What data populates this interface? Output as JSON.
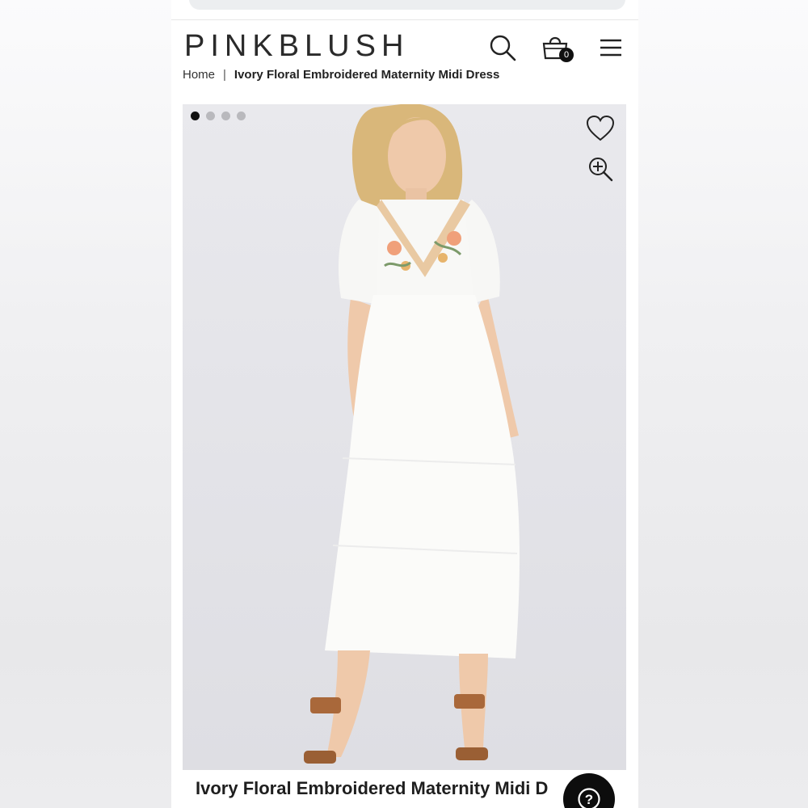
{
  "header": {
    "logo": "PINKBLUSH",
    "cart_count": "0",
    "icons": [
      "search-icon",
      "cart-icon",
      "menu-icon"
    ]
  },
  "breadcrumb": {
    "home": "Home",
    "separator": "|",
    "current": "Ivory Floral Embroidered Maternity Midi Dress"
  },
  "gallery": {
    "dot_count": 4,
    "active_index": 0,
    "icons": [
      "heart-icon",
      "zoom-in-icon"
    ]
  },
  "product": {
    "title": "Ivory Floral Embroidered Maternity Midi D"
  },
  "help": {
    "icon": "help-icon",
    "glyph": "?"
  },
  "colors": {
    "text": "#1e1e1e",
    "badge": "#111111",
    "dot_inactive": "#b9b9bd"
  }
}
